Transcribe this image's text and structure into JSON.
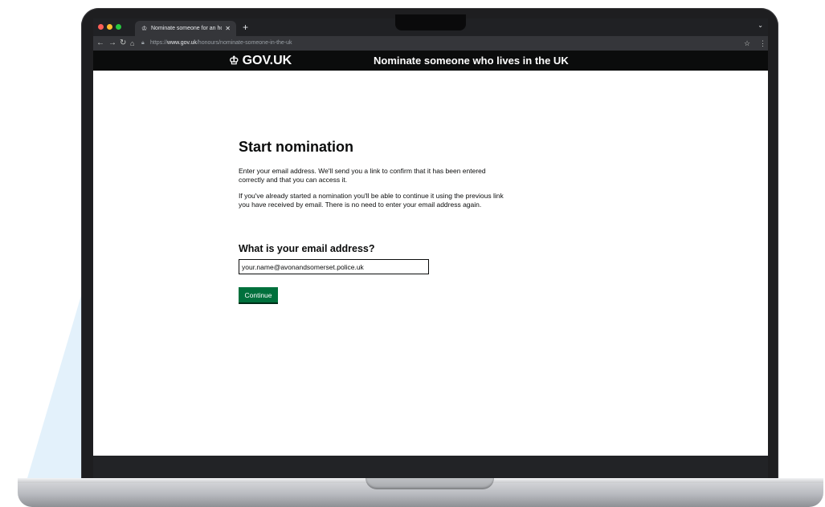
{
  "browser": {
    "tab_title": "Nominate someone for an hono",
    "url_scheme": "https://",
    "url_host": "www.gov.uk",
    "url_path": "/honours/nominate-someone-in-the-uk",
    "icons": {
      "tab_favicon": "crown-icon",
      "close_tab": "close-icon",
      "new_tab": "plus-icon",
      "back": "back-arrow-icon",
      "forward": "forward-arrow-icon",
      "reload": "reload-icon",
      "home": "home-icon",
      "lock": "lock-icon",
      "bookmark": "star-icon",
      "menu": "kebab-menu-icon"
    },
    "traffic_lights": [
      "#ff5f57",
      "#febc2e",
      "#28c840"
    ]
  },
  "gov_header": {
    "logo_text": "GOV.UK",
    "service_name": "Nominate someone who lives in the UK"
  },
  "main": {
    "heading": "Start nomination",
    "para1": "Enter your email address. We'll send you a link to confirm that it has been entered correctly and that you can access it.",
    "para2": "If you've already started a nomination you'll be able to continue it using the previous link you have received by email. There is no need to enter your email address again.",
    "email_label": "What is your email address?",
    "email_value": "your.name@avonandsomerset.police.uk",
    "continue_label": "Continue"
  },
  "colors": {
    "gov_header_bg": "#0b0c0c",
    "button_green": "#00703c",
    "beam": "#e3f1fb"
  }
}
